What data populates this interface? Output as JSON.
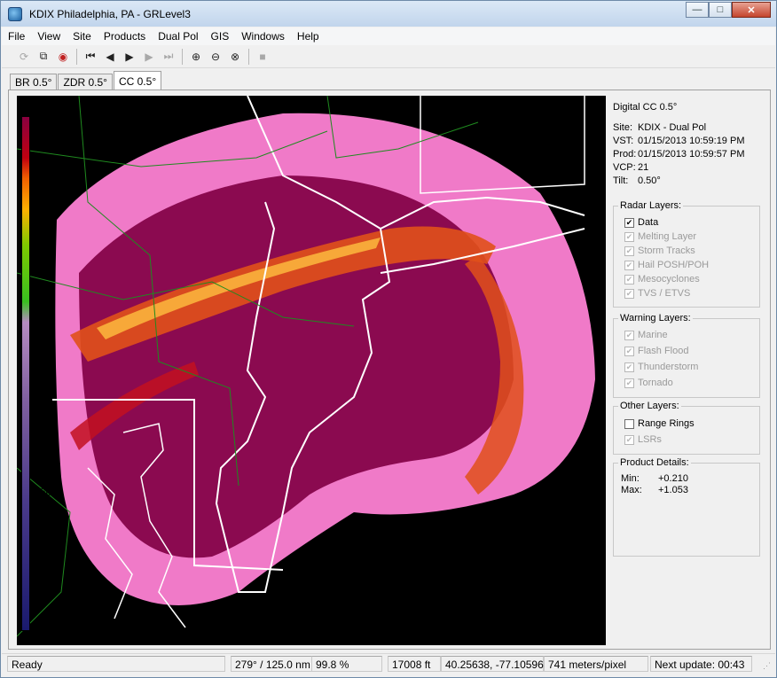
{
  "window": {
    "title": "KDIX Philadelphia, PA - GRLevel3",
    "min_label": "—",
    "max_label": "□",
    "close_label": "✕"
  },
  "menu": [
    "File",
    "View",
    "Site",
    "Products",
    "Dual Pol",
    "GIS",
    "Windows",
    "Help"
  ],
  "tabs": [
    "BR 0.5°",
    "ZDR 0.5°",
    "CC 0.5°"
  ],
  "active_tab": "CC 0.5°",
  "scale": {
    "unit": "%",
    "ticks": [
      "100",
      "95",
      "90",
      "85",
      "80",
      "75",
      "70",
      "65",
      "60",
      "55",
      "50",
      "45"
    ]
  },
  "info": {
    "product": "Digital CC 0.5°",
    "site_label": "Site:",
    "site": "KDIX - Dual Pol",
    "vst_label": "VST:",
    "vst": "01/15/2013  10:59:19 PM",
    "prod_label": "Prod:",
    "prod": "01/15/2013  10:59:57 PM",
    "vcp_label": "VCP:",
    "vcp": "21",
    "tilt_label": "Tilt:",
    "tilt": "0.50°"
  },
  "radar_layers": {
    "title": "Radar Layers:",
    "items": [
      {
        "label": "Data",
        "checked": true,
        "enabled": true
      },
      {
        "label": "Melting Layer",
        "checked": true,
        "enabled": false
      },
      {
        "label": "Storm Tracks",
        "checked": true,
        "enabled": false
      },
      {
        "label": "Hail POSH/POH",
        "checked": true,
        "enabled": false
      },
      {
        "label": "Mesocyclones",
        "checked": true,
        "enabled": false
      },
      {
        "label": "TVS / ETVS",
        "checked": true,
        "enabled": false
      }
    ]
  },
  "warning_layers": {
    "title": "Warning Layers:",
    "items": [
      {
        "label": "Marine",
        "checked": true,
        "enabled": false
      },
      {
        "label": "Flash Flood",
        "checked": true,
        "enabled": false
      },
      {
        "label": "Thunderstorm",
        "checked": true,
        "enabled": false
      },
      {
        "label": "Tornado",
        "checked": true,
        "enabled": false
      }
    ]
  },
  "other_layers": {
    "title": "Other Layers:",
    "items": [
      {
        "label": "Range Rings",
        "checked": false,
        "enabled": true
      },
      {
        "label": "LSRs",
        "checked": true,
        "enabled": false
      }
    ]
  },
  "product_details": {
    "title": "Product Details:",
    "min_label": "Min:",
    "min": "+0.210",
    "max_label": "Max:",
    "max": "+1.053"
  },
  "status": {
    "ready": "Ready",
    "bearing": "279° / 125.0 nm",
    "value": "99.8 %",
    "height": "17008 ft",
    "coords": "40.25638, -77.10596",
    "resolution": "741 meters/pixel",
    "next_update": "Next update: 00:43"
  },
  "colors": {
    "title_gradient_top": "#dbe8f6",
    "title_gradient_bottom": "#c1d5ec",
    "radar_magenta": "#8b0a50",
    "radar_pink": "#f07ac8",
    "radar_orange": "#f06000"
  }
}
